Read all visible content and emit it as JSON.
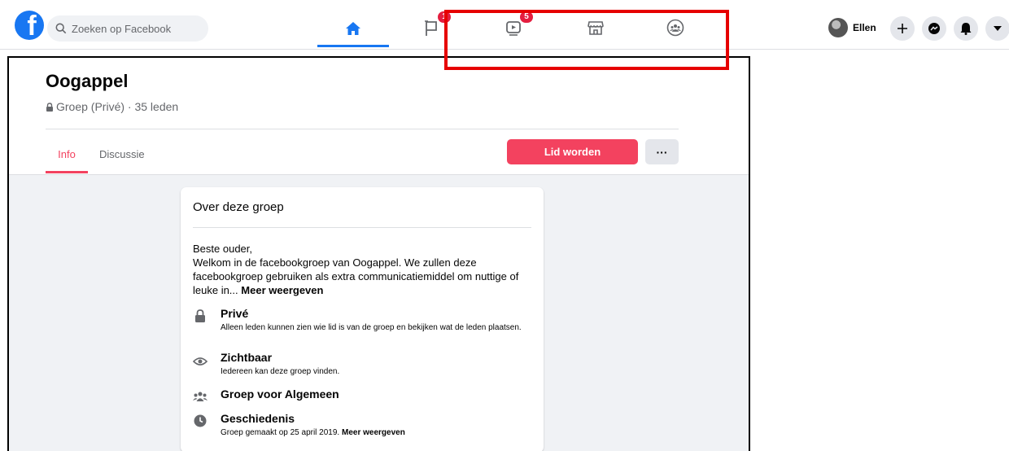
{
  "topbar": {
    "search_placeholder": "Zoeken op Facebook",
    "nav": [
      {
        "name": "home",
        "badge": ""
      },
      {
        "name": "pages",
        "badge": "1"
      },
      {
        "name": "watch",
        "badge": "5"
      },
      {
        "name": "marketplace",
        "badge": ""
      },
      {
        "name": "groups",
        "badge": ""
      }
    ],
    "profile_name": "Ellen",
    "accent_color": "#1877f2"
  },
  "group": {
    "title": "Oogappel",
    "meta": "Groep (Privé) · 35 leden",
    "tabs": [
      "Info",
      "Discussie"
    ],
    "join_label": "Lid worden",
    "more_label": "···"
  },
  "about": {
    "title": "Over deze groep",
    "description_lines": [
      "Beste ouder,",
      "Welkom in de facebookgroep van Oogappel. We zullen deze",
      "facebookgroep gebruiken als extra communicatiemiddel om nuttige of",
      "leuke in..."
    ],
    "see_more": "Meer weergeven",
    "private_title": "Privé",
    "private_desc": "Alleen leden kunnen zien wie lid is van de groep en bekijken wat de leden plaatsen.",
    "visible_title": "Zichtbaar",
    "visible_desc": "Iedereen kan deze groep vinden.",
    "category_title": "Groep voor Algemeen",
    "history_title": "Geschiedenis",
    "history_desc": "Groep gemaakt op 25 april 2019.",
    "history_more": "Meer weergeven"
  },
  "colors": {
    "join": "#f3425f",
    "highlight_box": "#e60000"
  }
}
